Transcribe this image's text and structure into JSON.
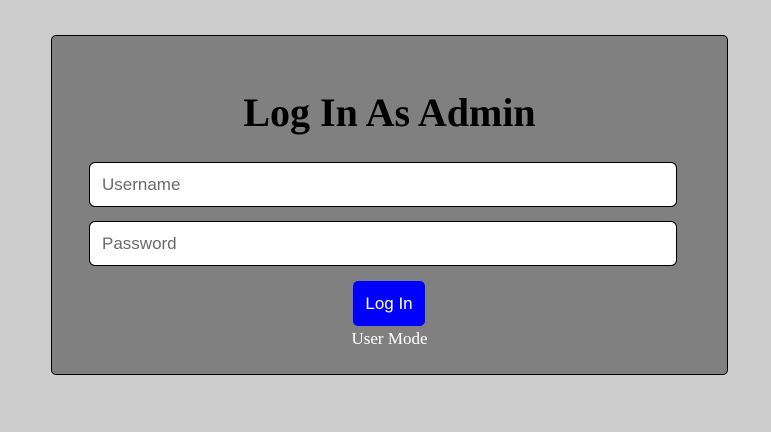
{
  "login_form": {
    "title": "Log In As Admin",
    "username": {
      "value": "",
      "placeholder": "Username"
    },
    "password": {
      "value": "",
      "placeholder": "Password"
    },
    "submit_label": "Log In",
    "mode_link_label": "User Mode"
  },
  "colors": {
    "page_background": "#cccccc",
    "panel_background": "#808080",
    "button_background": "#0000ff",
    "button_text": "#ffffff",
    "link_text": "#ffffff"
  }
}
